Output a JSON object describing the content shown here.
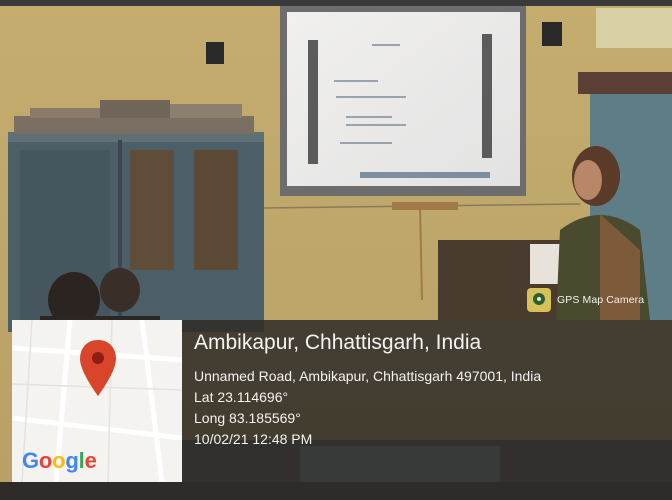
{
  "overlay": {
    "app_badge": "GPS Map Camera",
    "app_icon": "gps-map-camera-icon",
    "map_icon": "map-pin-icon",
    "map_brand": {
      "letters": [
        "G",
        "o",
        "o",
        "g",
        "l",
        "e"
      ],
      "colors": [
        "#4285F4",
        "#EA4335",
        "#FBBC05",
        "#4285F4",
        "#34A853",
        "#EA4335"
      ]
    },
    "location_title": "Ambikapur, Chhattisgarh, India",
    "address": "Unnamed Road, Ambikapur, Chhattisgarh 497001, India",
    "latitude": "Lat 23.114696°",
    "longitude": "Long 83.185569°",
    "datetime": "10/02/21 12:48 PM"
  },
  "colors": {
    "wall": "#c9b57a",
    "pin": "#d9452b"
  }
}
